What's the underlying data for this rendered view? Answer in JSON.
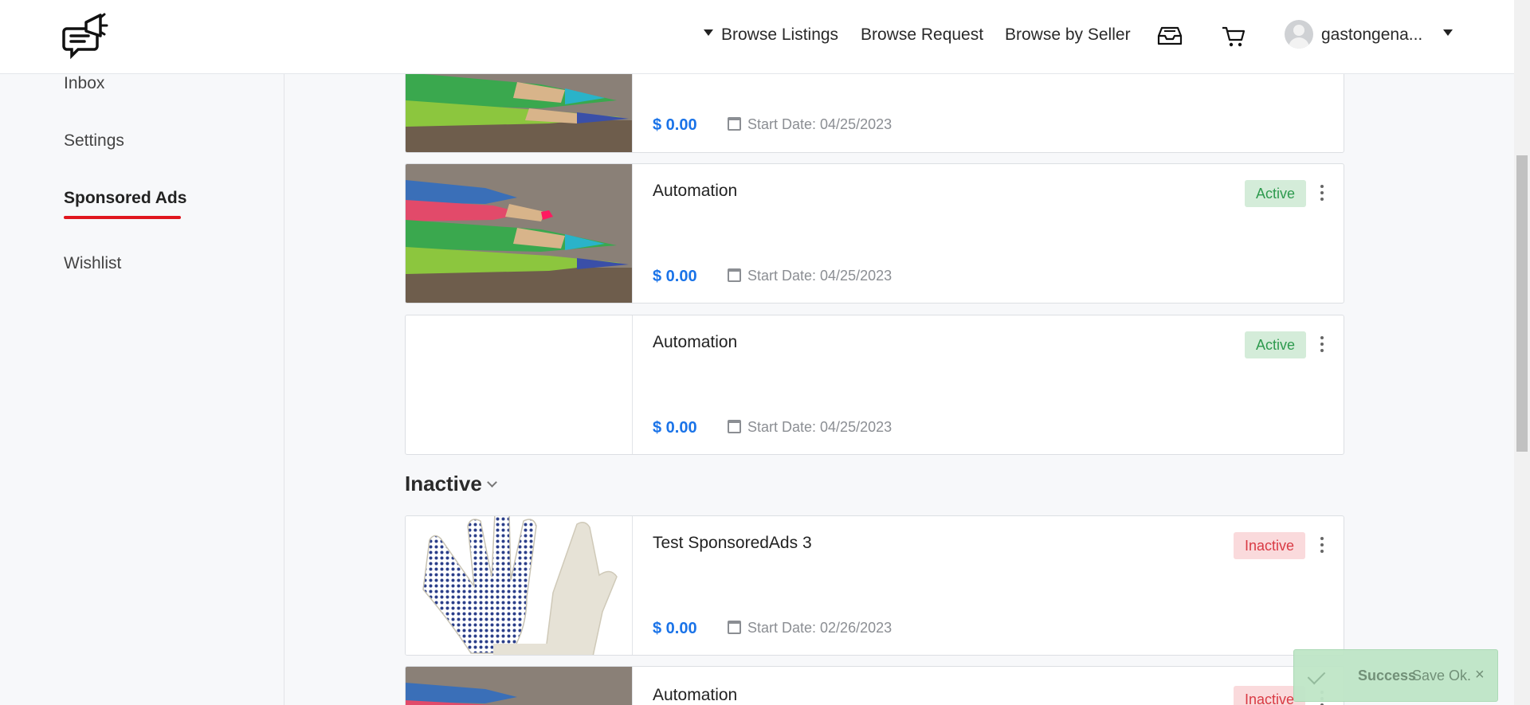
{
  "header": {
    "nav": {
      "browse_listings": "Browse Listings",
      "browse_request": "Browse Request",
      "browse_by_seller": "Browse by Seller"
    },
    "icons": [
      "logo-icon",
      "inbox-tray-icon",
      "cart-icon",
      "avatar-icon",
      "caret-down-icon"
    ],
    "username": "gastongena..."
  },
  "sidebar": {
    "items": [
      {
        "label": "Inbox"
      },
      {
        "label": "Settings"
      },
      {
        "label": "Sponsored Ads",
        "active": true
      },
      {
        "label": "Wishlist"
      }
    ]
  },
  "ads": {
    "partial": {
      "price": "$ 0.00",
      "start": "Start Date: 04/25/2023"
    },
    "active": [
      {
        "title": "Automation",
        "status": "Active",
        "price": "$ 0.00",
        "start": "Start Date: 04/25/2023",
        "image": "colored-pencils"
      },
      {
        "title": "Automation",
        "status": "Active",
        "price": "$ 0.00",
        "start": "Start Date: 04/25/2023",
        "image": "none"
      }
    ],
    "inactive_section": "Inactive",
    "inactive": [
      {
        "title": "Test SponsoredAds 3",
        "status": "Inactive",
        "price": "$ 0.00",
        "start": "Start Date: 02/26/2023",
        "image": "work-glove"
      },
      {
        "title": "Automation",
        "status": "Inactive",
        "image": "colored-pencils"
      }
    ]
  },
  "colors": {
    "accent_red": "#e0161e",
    "price_blue": "#1a73e8",
    "active_bg": "#d4ecd9",
    "inactive_bg": "#fadadc"
  },
  "toast": {
    "title": "Success",
    "message": "Save Ok.",
    "close": "×"
  }
}
